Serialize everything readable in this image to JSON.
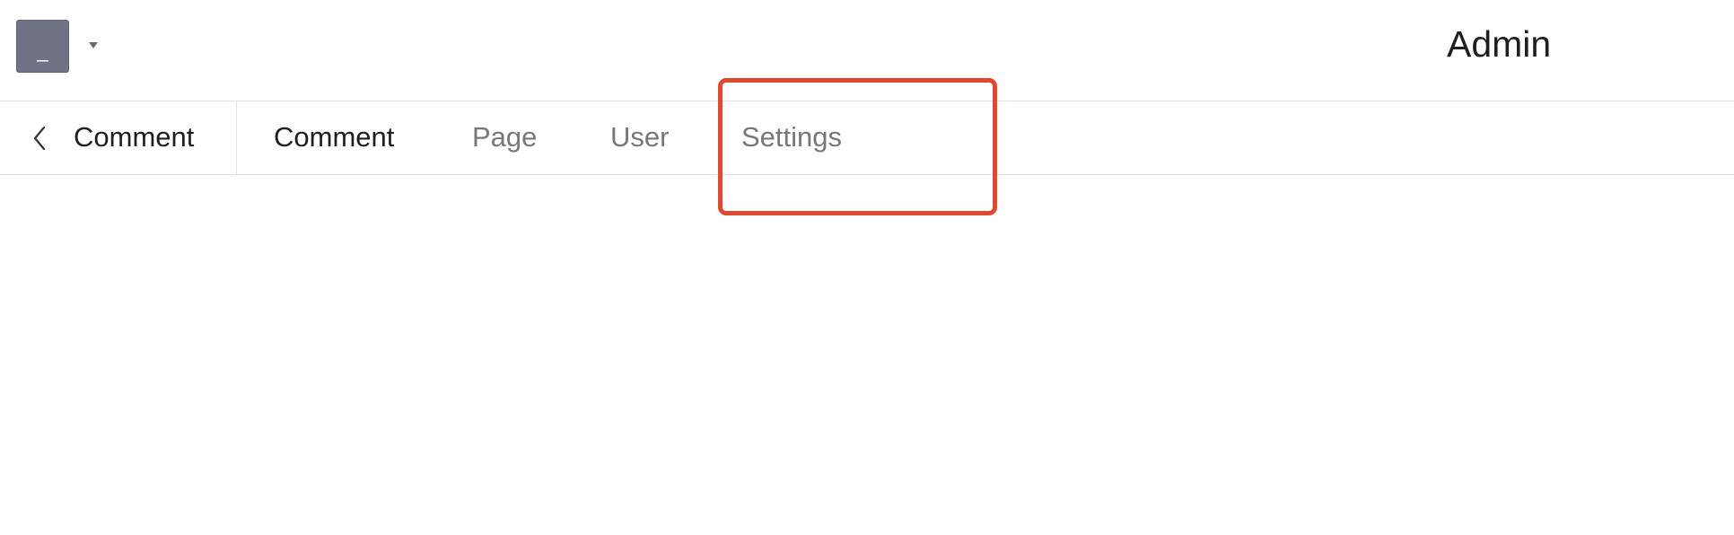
{
  "header": {
    "app_icon_glyph": "_",
    "app_icon_color": "#6f7385",
    "dropdown_icon": "caret-down-icon",
    "admin_label": "Admin"
  },
  "tabbar": {
    "back": {
      "icon": "chevron-left-icon",
      "label": "Comment"
    },
    "tabs": [
      {
        "label": "Comment",
        "active": true
      },
      {
        "label": "Page",
        "active": false
      },
      {
        "label": "User",
        "active": false
      },
      {
        "label": "Settings",
        "active": false
      }
    ]
  },
  "highlight": {
    "target": "Settings",
    "color": "#e2472f"
  }
}
